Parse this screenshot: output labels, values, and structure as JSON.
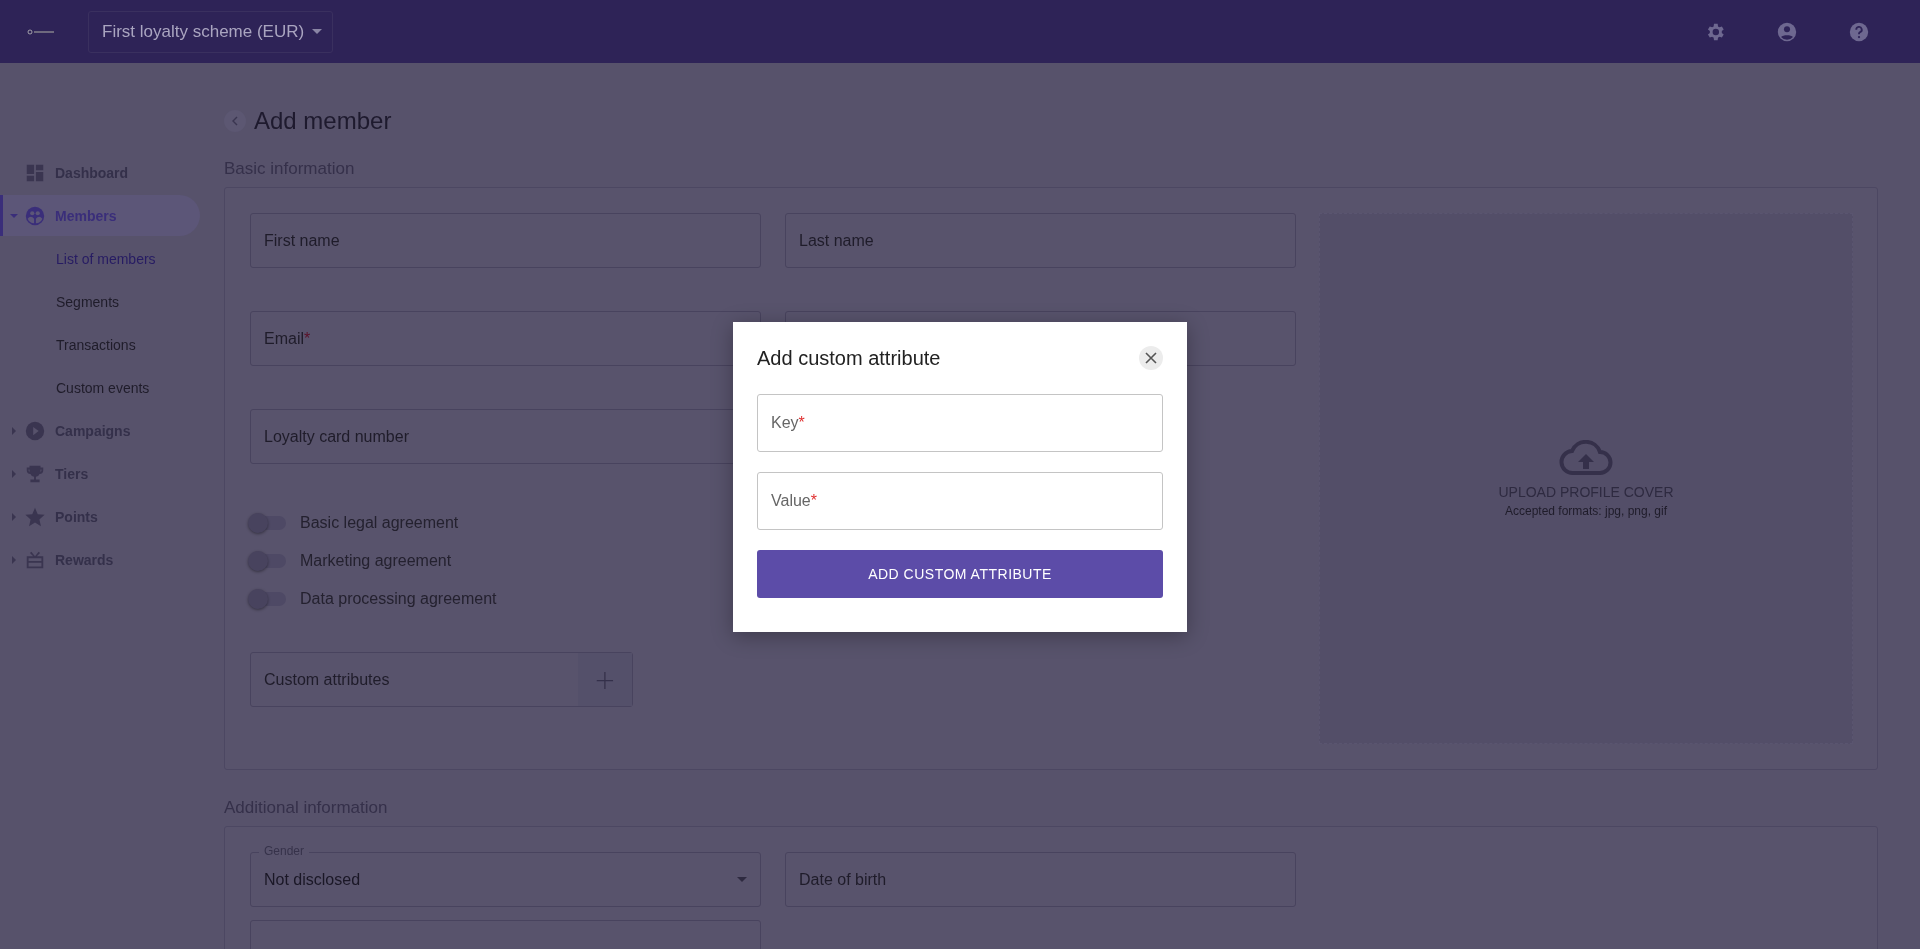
{
  "topbar": {
    "scheme_selector": "First loyalty scheme (EUR)"
  },
  "sidebar": {
    "items": [
      {
        "label": "Dashboard",
        "expandable": false,
        "selected": false
      },
      {
        "label": "Members",
        "expandable": true,
        "expanded": true,
        "selected": true,
        "children": [
          {
            "label": "List of members",
            "selected": true
          },
          {
            "label": "Segments",
            "selected": false
          },
          {
            "label": "Transactions",
            "selected": false
          },
          {
            "label": "Custom events",
            "selected": false
          }
        ]
      },
      {
        "label": "Campaigns",
        "expandable": true,
        "expanded": false,
        "selected": false
      },
      {
        "label": "Tiers",
        "expandable": true,
        "expanded": false,
        "selected": false
      },
      {
        "label": "Points",
        "expandable": true,
        "expanded": false,
        "selected": false
      },
      {
        "label": "Rewards",
        "expandable": true,
        "expanded": false,
        "selected": false
      }
    ]
  },
  "page": {
    "title": "Add member",
    "basic": {
      "heading": "Basic information",
      "fields": [
        {
          "placeholder": "First name"
        },
        {
          "placeholder": "Last name"
        },
        {
          "placeholder": "Email",
          "required_mark": "*"
        },
        {
          "placeholder": "Loyalty card number"
        }
      ],
      "agreements": [
        {
          "label": "Basic legal agreement",
          "on": false
        },
        {
          "label": "Marketing agreement",
          "on": false
        },
        {
          "label": "Data processing agreement",
          "on": false
        }
      ],
      "custom_attributes": {
        "placeholder": "Custom attributes",
        "add_button": "+"
      },
      "upload": {
        "title": "UPLOAD PROFILE COVER",
        "hint": "Accepted formats: jpg, png, gif"
      }
    },
    "additional": {
      "heading": "Additional information",
      "fields": [
        {
          "kind": "select",
          "label": "Gender",
          "value": "Not disclosed"
        },
        {
          "kind": "input",
          "placeholder": "Date of birth"
        },
        {
          "kind": "input"
        }
      ]
    }
  },
  "dialog": {
    "title": "Add custom attribute",
    "fields": [
      {
        "placeholder": "Key",
        "required_mark": "*"
      },
      {
        "placeholder": "Value",
        "required_mark": "*"
      }
    ],
    "submit": "ADD CUSTOM ATTRIBUTE"
  }
}
